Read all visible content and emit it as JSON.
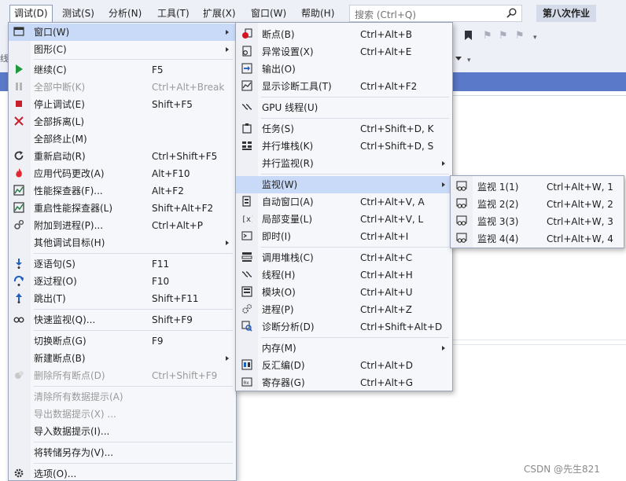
{
  "menubar": {
    "items": [
      "调试(D)",
      "测试(S)",
      "分析(N)",
      "工具(T)",
      "扩展(X)",
      "窗口(W)",
      "帮助(H)"
    ],
    "search_placeholder": "搜索 (Ctrl+Q)",
    "project_name": "第八次作业",
    "left_fragment": "线"
  },
  "debug_menu": {
    "items": [
      {
        "icon": "window-icon",
        "label": "窗口(W)",
        "shortcut": "",
        "submenu": true
      },
      {
        "icon": "graphics-icon",
        "label": "图形(C)",
        "shortcut": "",
        "submenu": true
      },
      {
        "icon": "play-icon",
        "label": "继续(C)",
        "shortcut": "F5"
      },
      {
        "icon": "pause-icon",
        "label": "全部中断(K)",
        "shortcut": "Ctrl+Alt+Break",
        "disabled": true
      },
      {
        "icon": "stop-icon",
        "label": "停止调试(E)",
        "shortcut": "Shift+F5"
      },
      {
        "icon": "detach-icon",
        "label": "全部拆离(L)",
        "shortcut": ""
      },
      {
        "icon": "",
        "label": "全部终止(M)",
        "shortcut": ""
      },
      {
        "icon": "restart-icon",
        "label": "重新启动(R)",
        "shortcut": "Ctrl+Shift+F5"
      },
      {
        "icon": "hot-reload-icon",
        "label": "应用代码更改(A)",
        "shortcut": "Alt+F10"
      },
      {
        "icon": "profiler-icon",
        "label": "性能探查器(F)...",
        "shortcut": "Alt+F2"
      },
      {
        "icon": "profiler-restart-icon",
        "label": "重启性能探查器(L)",
        "shortcut": "Shift+Alt+F2"
      },
      {
        "icon": "attach-icon",
        "label": "附加到进程(P)...",
        "shortcut": "Ctrl+Alt+P"
      },
      {
        "icon": "",
        "label": "其他调试目标(H)",
        "shortcut": "",
        "submenu": true
      },
      {
        "icon": "step-into-icon",
        "label": "逐语句(S)",
        "shortcut": "F11"
      },
      {
        "icon": "step-over-icon",
        "label": "逐过程(O)",
        "shortcut": "F10"
      },
      {
        "icon": "step-out-icon",
        "label": "跳出(T)",
        "shortcut": "Shift+F11"
      },
      {
        "icon": "quickwatch-icon",
        "label": "快速监视(Q)...",
        "shortcut": "Shift+F9"
      },
      {
        "icon": "",
        "label": "切换断点(G)",
        "shortcut": "F9"
      },
      {
        "icon": "",
        "label": "新建断点(B)",
        "shortcut": "",
        "submenu": true
      },
      {
        "icon": "delete-breakpoints-icon",
        "label": "删除所有断点(D)",
        "shortcut": "Ctrl+Shift+F9",
        "disabled": true
      },
      {
        "icon": "",
        "label": "清除所有数据提示(A)",
        "shortcut": "",
        "disabled": true
      },
      {
        "icon": "",
        "label": "导出数据提示(X) ...",
        "shortcut": "",
        "disabled": true
      },
      {
        "icon": "",
        "label": "导入数据提示(I)...",
        "shortcut": ""
      },
      {
        "icon": "",
        "label": "将转储另存为(V)...",
        "shortcut": ""
      },
      {
        "icon": "options-gear-icon",
        "label": "选项(O)...",
        "shortcut": ""
      }
    ]
  },
  "window_menu": {
    "items": [
      {
        "icon": "breakpoint-icon",
        "label": "断点(B)",
        "shortcut": "Ctrl+Alt+B"
      },
      {
        "icon": "exception-settings-icon",
        "label": "异常设置(X)",
        "shortcut": "Ctrl+Alt+E"
      },
      {
        "icon": "output-icon",
        "label": "输出(O)",
        "shortcut": ""
      },
      {
        "icon": "diagnostic-tools-icon",
        "label": "显示诊断工具(T)",
        "shortcut": "Ctrl+Alt+F2"
      },
      {
        "icon": "gpu-threads-icon",
        "label": "GPU 线程(U)",
        "shortcut": ""
      },
      {
        "icon": "tasks-icon",
        "label": "任务(S)",
        "shortcut": "Ctrl+Shift+D, K"
      },
      {
        "icon": "parallel-stacks-icon",
        "label": "并行堆栈(K)",
        "shortcut": "Ctrl+Shift+D, S"
      },
      {
        "icon": "",
        "label": "并行监视(R)",
        "shortcut": "",
        "submenu": true
      },
      {
        "icon": "",
        "label": "监视(W)",
        "shortcut": "",
        "submenu": true
      },
      {
        "icon": "autos-icon",
        "label": "自动窗口(A)",
        "shortcut": "Ctrl+Alt+V, A"
      },
      {
        "icon": "locals-icon",
        "label": "局部变量(L)",
        "shortcut": "Ctrl+Alt+V, L"
      },
      {
        "icon": "immediate-icon",
        "label": "即时(I)",
        "shortcut": "Ctrl+Alt+I"
      },
      {
        "icon": "call-stack-icon",
        "label": "调用堆栈(C)",
        "shortcut": "Ctrl+Alt+C"
      },
      {
        "icon": "threads-icon",
        "label": "线程(H)",
        "shortcut": "Ctrl+Alt+H"
      },
      {
        "icon": "modules-icon",
        "label": "模块(O)",
        "shortcut": "Ctrl+Alt+U"
      },
      {
        "icon": "processes-icon",
        "label": "进程(P)",
        "shortcut": "Ctrl+Alt+Z"
      },
      {
        "icon": "diagnostics-icon",
        "label": "诊断分析(D)",
        "shortcut": "Ctrl+Shift+Alt+D"
      },
      {
        "icon": "",
        "label": "内存(M)",
        "shortcut": "",
        "submenu": true
      },
      {
        "icon": "disassembly-icon",
        "label": "反汇编(D)",
        "shortcut": "Ctrl+Alt+D"
      },
      {
        "icon": "registers-icon",
        "label": "寄存器(G)",
        "shortcut": "Ctrl+Alt+G"
      }
    ]
  },
  "watch_menu": {
    "items": [
      {
        "icon": "watch-icon",
        "label": "监视 1(1)",
        "shortcut": "Ctrl+Alt+W, 1"
      },
      {
        "icon": "watch-icon",
        "label": "监视 2(2)",
        "shortcut": "Ctrl+Alt+W, 2"
      },
      {
        "icon": "watch-icon",
        "label": "监视 3(3)",
        "shortcut": "Ctrl+Alt+W, 3"
      },
      {
        "icon": "watch-icon",
        "label": "监视 4(4)",
        "shortcut": "Ctrl+Alt+W, 4"
      }
    ]
  },
  "watermark": "CSDN @先生821",
  "colors": {
    "menubar_bg": "#eef0f7",
    "menu_bg": "#f6f7fb",
    "highlight": "#c9daf8",
    "accent_blue": "#5a79c9"
  }
}
